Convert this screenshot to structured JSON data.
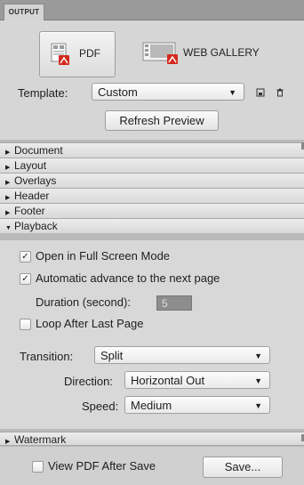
{
  "panel": {
    "tab_label": "OUTPUT"
  },
  "modes": {
    "pdf_label": "PDF",
    "web_label": "WEB GALLERY"
  },
  "template": {
    "label": "Template:",
    "value": "Custom",
    "refresh_label": "Refresh Preview"
  },
  "sections": [
    {
      "label": "Document",
      "expanded": false
    },
    {
      "label": "Layout",
      "expanded": false
    },
    {
      "label": "Overlays",
      "expanded": false
    },
    {
      "label": "Header",
      "expanded": false
    },
    {
      "label": "Footer",
      "expanded": false
    },
    {
      "label": "Playback",
      "expanded": true
    }
  ],
  "playback": {
    "full_screen_label": "Open in Full Screen Mode",
    "full_screen_checked": true,
    "auto_advance_label": "Automatic advance to the next page",
    "auto_advance_checked": true,
    "duration_label": "Duration (second):",
    "duration_value": "5",
    "loop_label": "Loop After Last Page",
    "loop_checked": false,
    "transition_label": "Transition:",
    "transition_value": "Split",
    "direction_label": "Direction:",
    "direction_value": "Horizontal Out",
    "speed_label": "Speed:",
    "speed_value": "Medium"
  },
  "watermark": {
    "label": "Watermark"
  },
  "footer": {
    "view_pdf_label": "View PDF After Save",
    "view_pdf_checked": false,
    "save_label": "Save..."
  },
  "icons": {
    "pdf": "pdf-document-icon",
    "web": "web-gallery-icon",
    "save_template": "save-template-icon",
    "delete_template": "trash-icon",
    "collapsed": "triangle-right-icon",
    "expanded": "triangle-down-icon",
    "dropdown": "chevron-down-icon",
    "check": "checkmark-icon"
  },
  "colors": {
    "panel_bg": "#d6d6d6",
    "header_bar": "#9a9a9a",
    "pdf_red": "#d42a1e"
  }
}
